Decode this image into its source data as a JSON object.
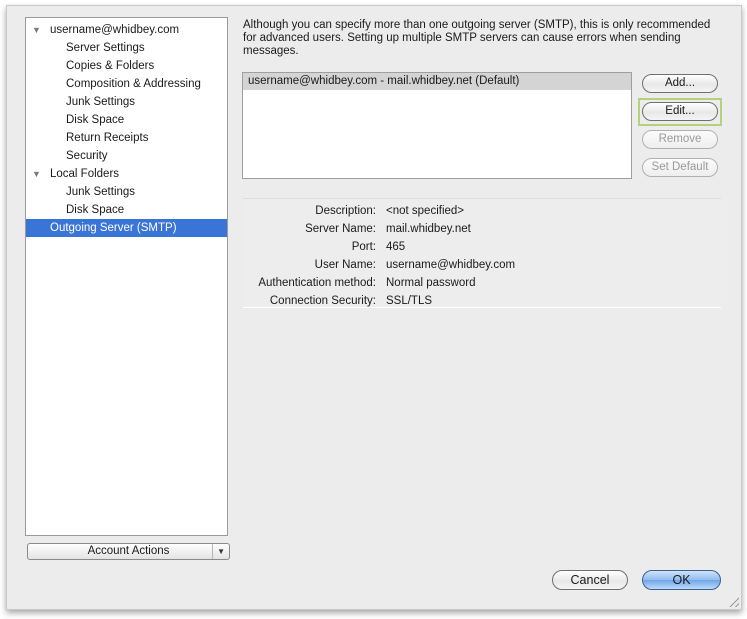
{
  "sidebar": {
    "items": [
      {
        "label": "username@whidbey.com",
        "level": 0,
        "expanded": true
      },
      {
        "label": "Server Settings",
        "level": 1
      },
      {
        "label": "Copies & Folders",
        "level": 1
      },
      {
        "label": "Composition & Addressing",
        "level": 1
      },
      {
        "label": "Junk Settings",
        "level": 1
      },
      {
        "label": "Disk Space",
        "level": 1
      },
      {
        "label": "Return Receipts",
        "level": 1
      },
      {
        "label": "Security",
        "level": 1
      },
      {
        "label": "Local Folders",
        "level": 0,
        "expanded": true
      },
      {
        "label": "Junk Settings",
        "level": 1
      },
      {
        "label": "Disk Space",
        "level": 1
      },
      {
        "label": "Outgoing Server (SMTP)",
        "level": 0,
        "selected": true
      }
    ],
    "account_actions_label": "Account Actions",
    "disclosure_icon": "▼",
    "dropdown_icon": "▼"
  },
  "main": {
    "info_text": "Although you can specify more than one outgoing server (SMTP), this is only recommended for advanced users. Setting up multiple SMTP servers can cause errors when sending messages.",
    "servers": [
      {
        "label": "username@whidbey.com - mail.whidbey.net (Default)",
        "selected": true
      }
    ],
    "buttons": {
      "add": "Add...",
      "edit": "Edit...",
      "remove": "Remove",
      "set_default": "Set Default"
    },
    "details": [
      {
        "label": "Description:",
        "value": "<not specified>"
      },
      {
        "label": "Server Name:",
        "value": "mail.whidbey.net"
      },
      {
        "label": "Port:",
        "value": "465"
      },
      {
        "label": "User Name:",
        "value": "username@whidbey.com"
      },
      {
        "label": "Authentication method:",
        "value": "Normal password"
      },
      {
        "label": "Connection Security:",
        "value": "SSL/TLS"
      }
    ]
  },
  "footer": {
    "cancel": "Cancel",
    "ok": "OK"
  },
  "colors": {
    "selection": "#3875d7",
    "highlight_outline": "#b6d07b"
  }
}
